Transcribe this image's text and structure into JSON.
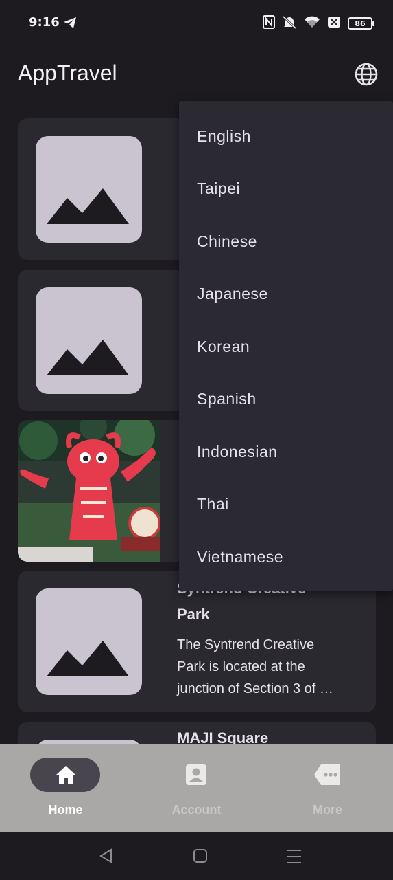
{
  "status_bar": {
    "time": "9:16",
    "battery": "86",
    "icons": [
      "telegram-icon",
      "nfc-icon",
      "mute-icon",
      "wifi-icon",
      "sim-off-icon",
      "battery-icon"
    ]
  },
  "app_bar": {
    "title": "AppTravel",
    "language_icon": "globe-icon"
  },
  "language_menu": {
    "items": [
      "English",
      "Taipei",
      "Chinese",
      "Japanese",
      "Korean",
      "Spanish",
      "Indonesian",
      "Thai",
      "Vietnamese"
    ]
  },
  "attractions": [
    {
      "title_line1": "",
      "title_line2": "",
      "desc": "",
      "image": "placeholder"
    },
    {
      "title_line1": "",
      "title_line2": "",
      "desc": "",
      "image": "placeholder"
    },
    {
      "title_line1": "",
      "title_line2": "",
      "desc": "",
      "image": "photo-dragon-lantern"
    },
    {
      "title_line1": "Syntrend Creative",
      "title_line2": "Park",
      "desc_lines": [
        "The Syntrend Creative",
        "Park is located at the",
        "junction of Section 3 of …"
      ],
      "image": "placeholder"
    },
    {
      "title_line1": "MAJI Square",
      "image": "placeholder"
    }
  ],
  "bottom_nav": {
    "items": [
      {
        "label": "Home",
        "icon": "home-icon",
        "active": true
      },
      {
        "label": "Account",
        "icon": "account-icon",
        "active": false
      },
      {
        "label": "More",
        "icon": "more-icon",
        "active": false
      }
    ]
  },
  "system_nav": [
    "back-icon",
    "home-square-icon",
    "recents-icon"
  ]
}
